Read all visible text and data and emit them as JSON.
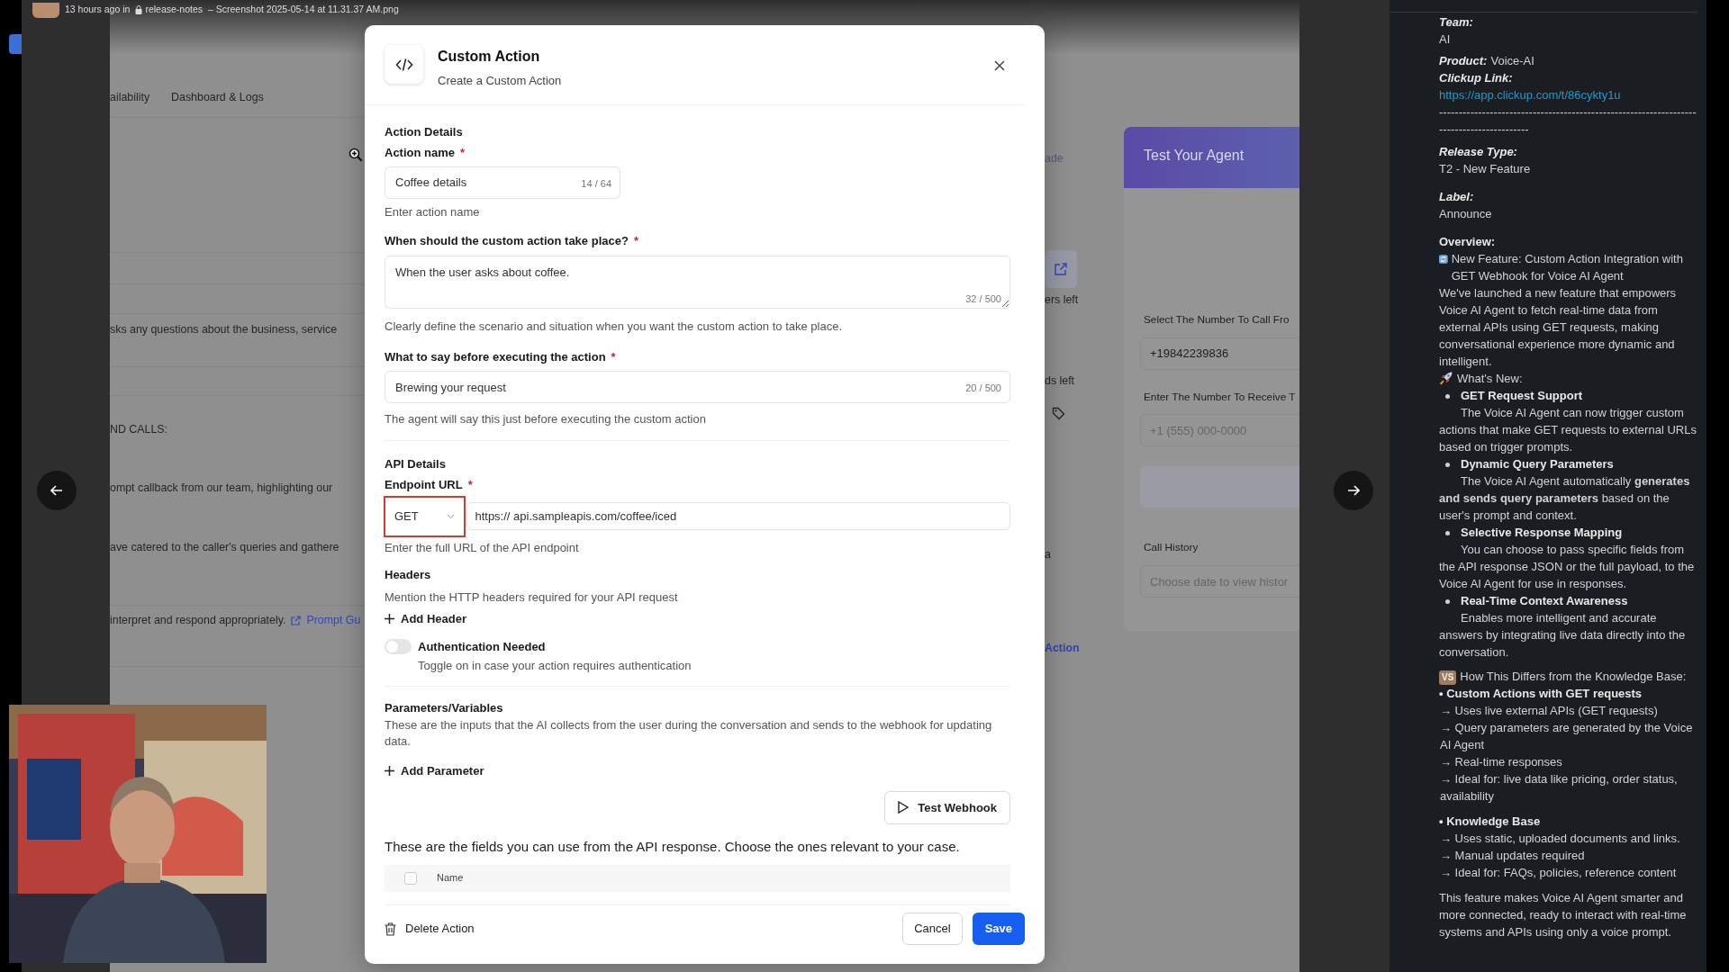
{
  "viewer": {
    "time": "13 hours ago in",
    "channel": "release-notes",
    "file": "– Screenshot 2025-05-14 at 11.31.37 AM.png"
  },
  "background_page": {
    "tabs": [
      {
        "label": "ailability"
      },
      {
        "label": "Dashboard & Logs"
      }
    ],
    "lines": [
      "sks any questions about the business, service",
      "ND CALLS:",
      "ompt callback from our team, highlighting our",
      "ave catered to the caller's queries and gathere"
    ],
    "note": "interpret and respond appropriately.",
    "note_link": "Prompt Gu",
    "button_label": "ade",
    "counter_1": "ers left",
    "counter_2": "ds left",
    "column_text": "a",
    "action_link": "Action",
    "test_panel": {
      "title": "Test Your Agent",
      "from_label": "Select The Number To Call Fro",
      "from_value": "+19842239836",
      "to_label": "Enter The Number To Receive T",
      "to_placeholder": "+1 (555) 000-0000",
      "history_label": "Call History",
      "history_placeholder": "Choose date to view histor"
    }
  },
  "modal": {
    "title": "Custom Action",
    "subtitle": "Create a Custom Action",
    "action_details": {
      "heading": "Action Details",
      "name": {
        "label": "Action name",
        "required_mark": "*",
        "value": "Coffee details",
        "counter": "14 / 64",
        "help": "Enter action name"
      },
      "trigger": {
        "label": "When should the custom action take place?",
        "required_mark": "*",
        "value": "When the user asks about coffee.",
        "counter": "32 / 500",
        "help": "Clearly define the scenario and situation when you want the custom action to take place."
      },
      "message": {
        "label": "What to say before executing the action",
        "required_mark": "*",
        "value": "Brewing your request",
        "counter": "20 / 500",
        "help": "The agent will say this just before executing the custom action"
      }
    },
    "api_details": {
      "heading": "API Details",
      "endpoint": {
        "label": "Endpoint URL",
        "required_mark": "*",
        "method": "GET",
        "highlighted": true,
        "url": "https:// api.sampleapis.com/coffee/iced",
        "help": "Enter the full URL of the API endpoint"
      },
      "headers": {
        "heading": "Headers",
        "help": "Mention the HTTP headers required for your API request",
        "add": "Add Header"
      },
      "auth": {
        "label": "Authentication Needed",
        "help": "Toggle on in case your action requires authentication",
        "on": false
      }
    },
    "parameters": {
      "heading": "Parameters/Variables",
      "help": "These are the inputs that the AI collects from the user during the conversation and sends to the webhook for updating data.",
      "add": "Add Parameter"
    },
    "test_button": "Test Webhook",
    "response_fields": {
      "intro": "These are the fields you can use from the API response. Choose the ones relevant to your case.",
      "columns": [
        {
          "label": "Name"
        }
      ],
      "all_checked": false
    },
    "footer": {
      "delete": "Delete Action",
      "cancel": "Cancel",
      "save": "Save"
    }
  },
  "thread": {
    "team": {
      "label": "Team:",
      "value": "AI"
    },
    "product": {
      "label": "Product:",
      "value": "Voice-AI"
    },
    "clickup": {
      "label": "Clickup Link:",
      "url": "https://app.clickup.com/t/86cykty1u"
    },
    "rule": "-----------------------------------------------------------------------------------------",
    "release_type": {
      "label": "Release Type:",
      "value": "T2 - New Feature"
    },
    "label": {
      "label": "Label:",
      "value": "Announce"
    },
    "overview": {
      "heading": "Overview:",
      "headline": "New Feature: Custom Action Integration with GET Webhook for Voice AI Agent",
      "intro": "We've launched a new feature that empowers Voice AI Agent to fetch real-time data from external APIs using GET requests, making conversational experience more dynamic and intelligent."
    },
    "whats_new": {
      "heading": "What's New:",
      "items": [
        {
          "title": "GET Request Support",
          "text": "The Voice AI Agent can now trigger custom actions that make GET requests to external URLs based on trigger prompts."
        },
        {
          "title": "Dynamic Query Parameters",
          "text": "The Voice AI Agent automatically **generates and sends query parameters** based on the user's prompt and context."
        },
        {
          "title": "Selective Response Mapping",
          "text": "You can choose to pass specific fields from the API response JSON or the full payload, to the Voice AI Agent for use in responses."
        },
        {
          "title": "Real-Time Context Awareness",
          "text": "Enables more intelligent and accurate answers by integrating live data directly into the conversation."
        }
      ]
    },
    "differs": {
      "badge": "VS",
      "heading": "How This Differs from the Knowledge Base:",
      "groups": [
        {
          "title": "• Custom Actions with GET requests",
          "points": [
            "→ Uses live external APIs (GET requests)",
            "→ Query parameters are generated by the Voice AI Agent",
            "→ Real-time responses",
            "→ Ideal for: live data like pricing, order status, availability"
          ]
        },
        {
          "title": "• Knowledge Base",
          "points": [
            "→ Uses static, uploaded documents and links.",
            "→ Manual updates required",
            "→ Ideal for: FAQs, policies, reference content"
          ]
        }
      ]
    },
    "closing": "This feature makes Voice AI Agent smarter and more connected, ready to interact with real-time systems and APIs using only a voice prompt."
  }
}
